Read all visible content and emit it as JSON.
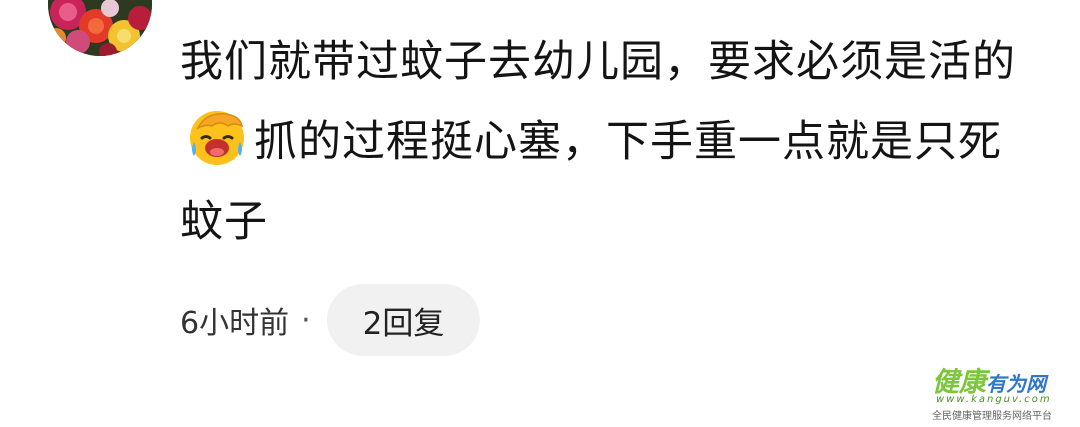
{
  "comment": {
    "text_before_emoji": "我们就带过蚊子去幼儿园，要求必须是活的",
    "text_after_emoji": "抓的过程挺心塞，下手重一点就是只死蚊子",
    "emoji": "facepalm-laughing-emoji"
  },
  "meta": {
    "timestamp": "6小时前",
    "separator": "·",
    "reply_label": "2回复"
  },
  "watermark": {
    "brand_main": "健康",
    "brand_sub": "有为网",
    "url": "www.kanguv.com",
    "slogan": "全民健康管理服务网络平台"
  },
  "colors": {
    "text": "#141414",
    "meta_text": "#333333",
    "reply_bg": "#f1f1f1",
    "watermark_green": "#7dc63b",
    "watermark_blue": "#2f78c8"
  }
}
